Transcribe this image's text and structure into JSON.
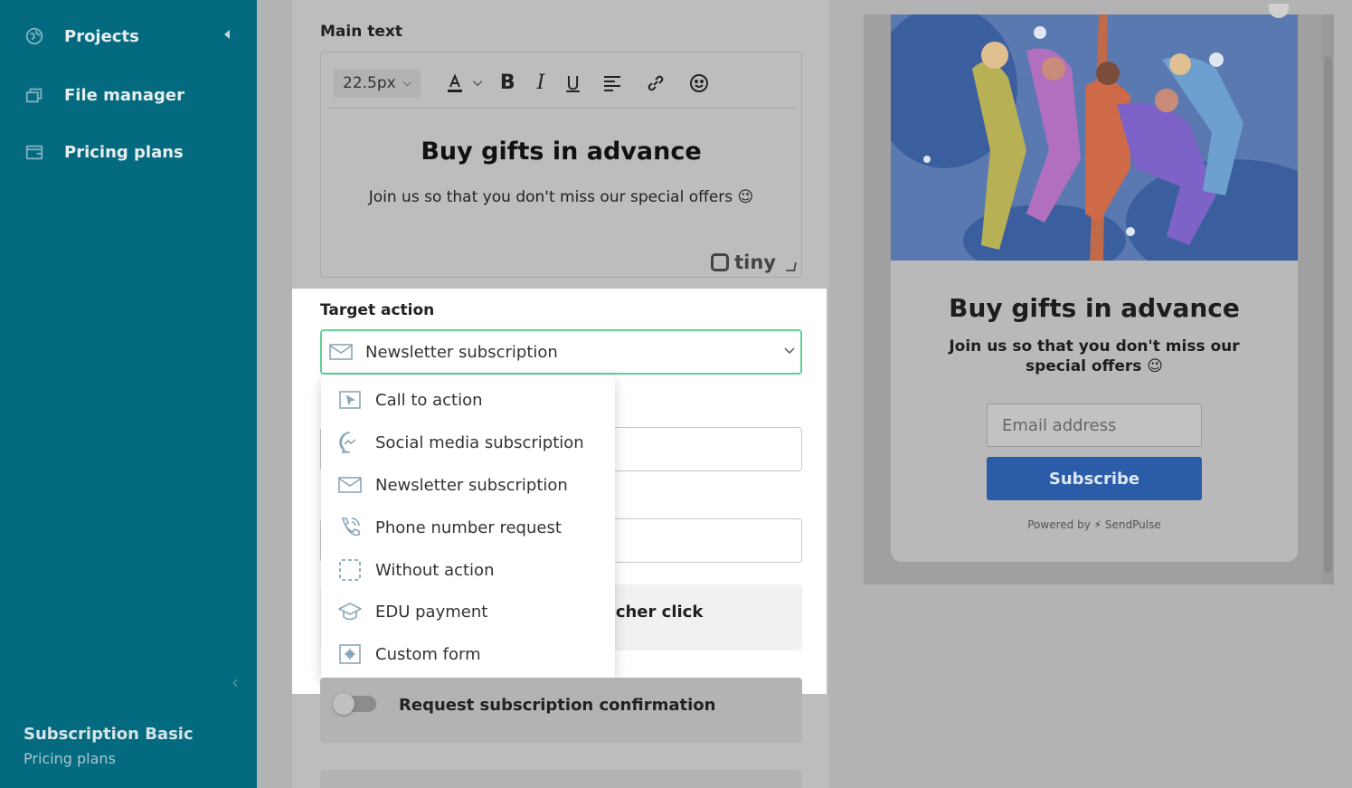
{
  "sidebar": {
    "items": [
      {
        "label": "Projects",
        "icon": "globe-icon"
      },
      {
        "label": "File manager",
        "icon": "folder-icon"
      },
      {
        "label": "Pricing plans",
        "icon": "wallet-icon"
      }
    ],
    "plan_title": "Subscription Basic",
    "plan_subtitle": "Pricing plans"
  },
  "editor": {
    "main_text_label": "Main text",
    "font_size": "22.5px",
    "heading": "Buy gifts in advance",
    "body": "Join us so that you don't miss our special offers 😉",
    "tiny_brand": "tiny"
  },
  "target_action": {
    "label": "Target action",
    "selected": "Newsletter subscription",
    "options": [
      {
        "label": "Call to action",
        "icon": "cursor-icon"
      },
      {
        "label": "Social media subscription",
        "icon": "messenger-icon"
      },
      {
        "label": "Newsletter subscription",
        "icon": "mail-icon"
      },
      {
        "label": "Phone number request",
        "icon": "phone-icon"
      },
      {
        "label": "Without action",
        "icon": "dashed-square-icon"
      },
      {
        "label": "EDU payment",
        "icon": "graduation-cap-icon"
      },
      {
        "label": "Custom form",
        "icon": "gear-form-icon"
      }
    ]
  },
  "settings": {
    "launcher_click_partial": "ncher click",
    "request_confirmation": "Request subscription confirmation"
  },
  "preview": {
    "title": "Buy gifts in advance",
    "text": "Join us so that you don't miss our special offers 😉",
    "email_placeholder": "Email address",
    "subscribe_label": "Subscribe",
    "powered_by": "Powered by",
    "brand": "SendPulse"
  },
  "colors": {
    "sidebar": "#046a7f",
    "accent_green": "#5fcf94",
    "button_blue": "#2a5ca8"
  }
}
